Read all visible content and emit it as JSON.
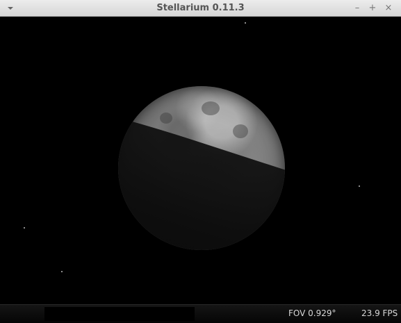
{
  "window": {
    "title": "Stellarium 0.11.3",
    "menu_icon": "chevron-down-icon",
    "controls": {
      "minimize": "–",
      "maximize": "+",
      "close": "×"
    }
  },
  "sky": {
    "object": "moon"
  },
  "status_bar": {
    "fov": "FOV 0.929°",
    "fps": "23.9 FPS"
  }
}
